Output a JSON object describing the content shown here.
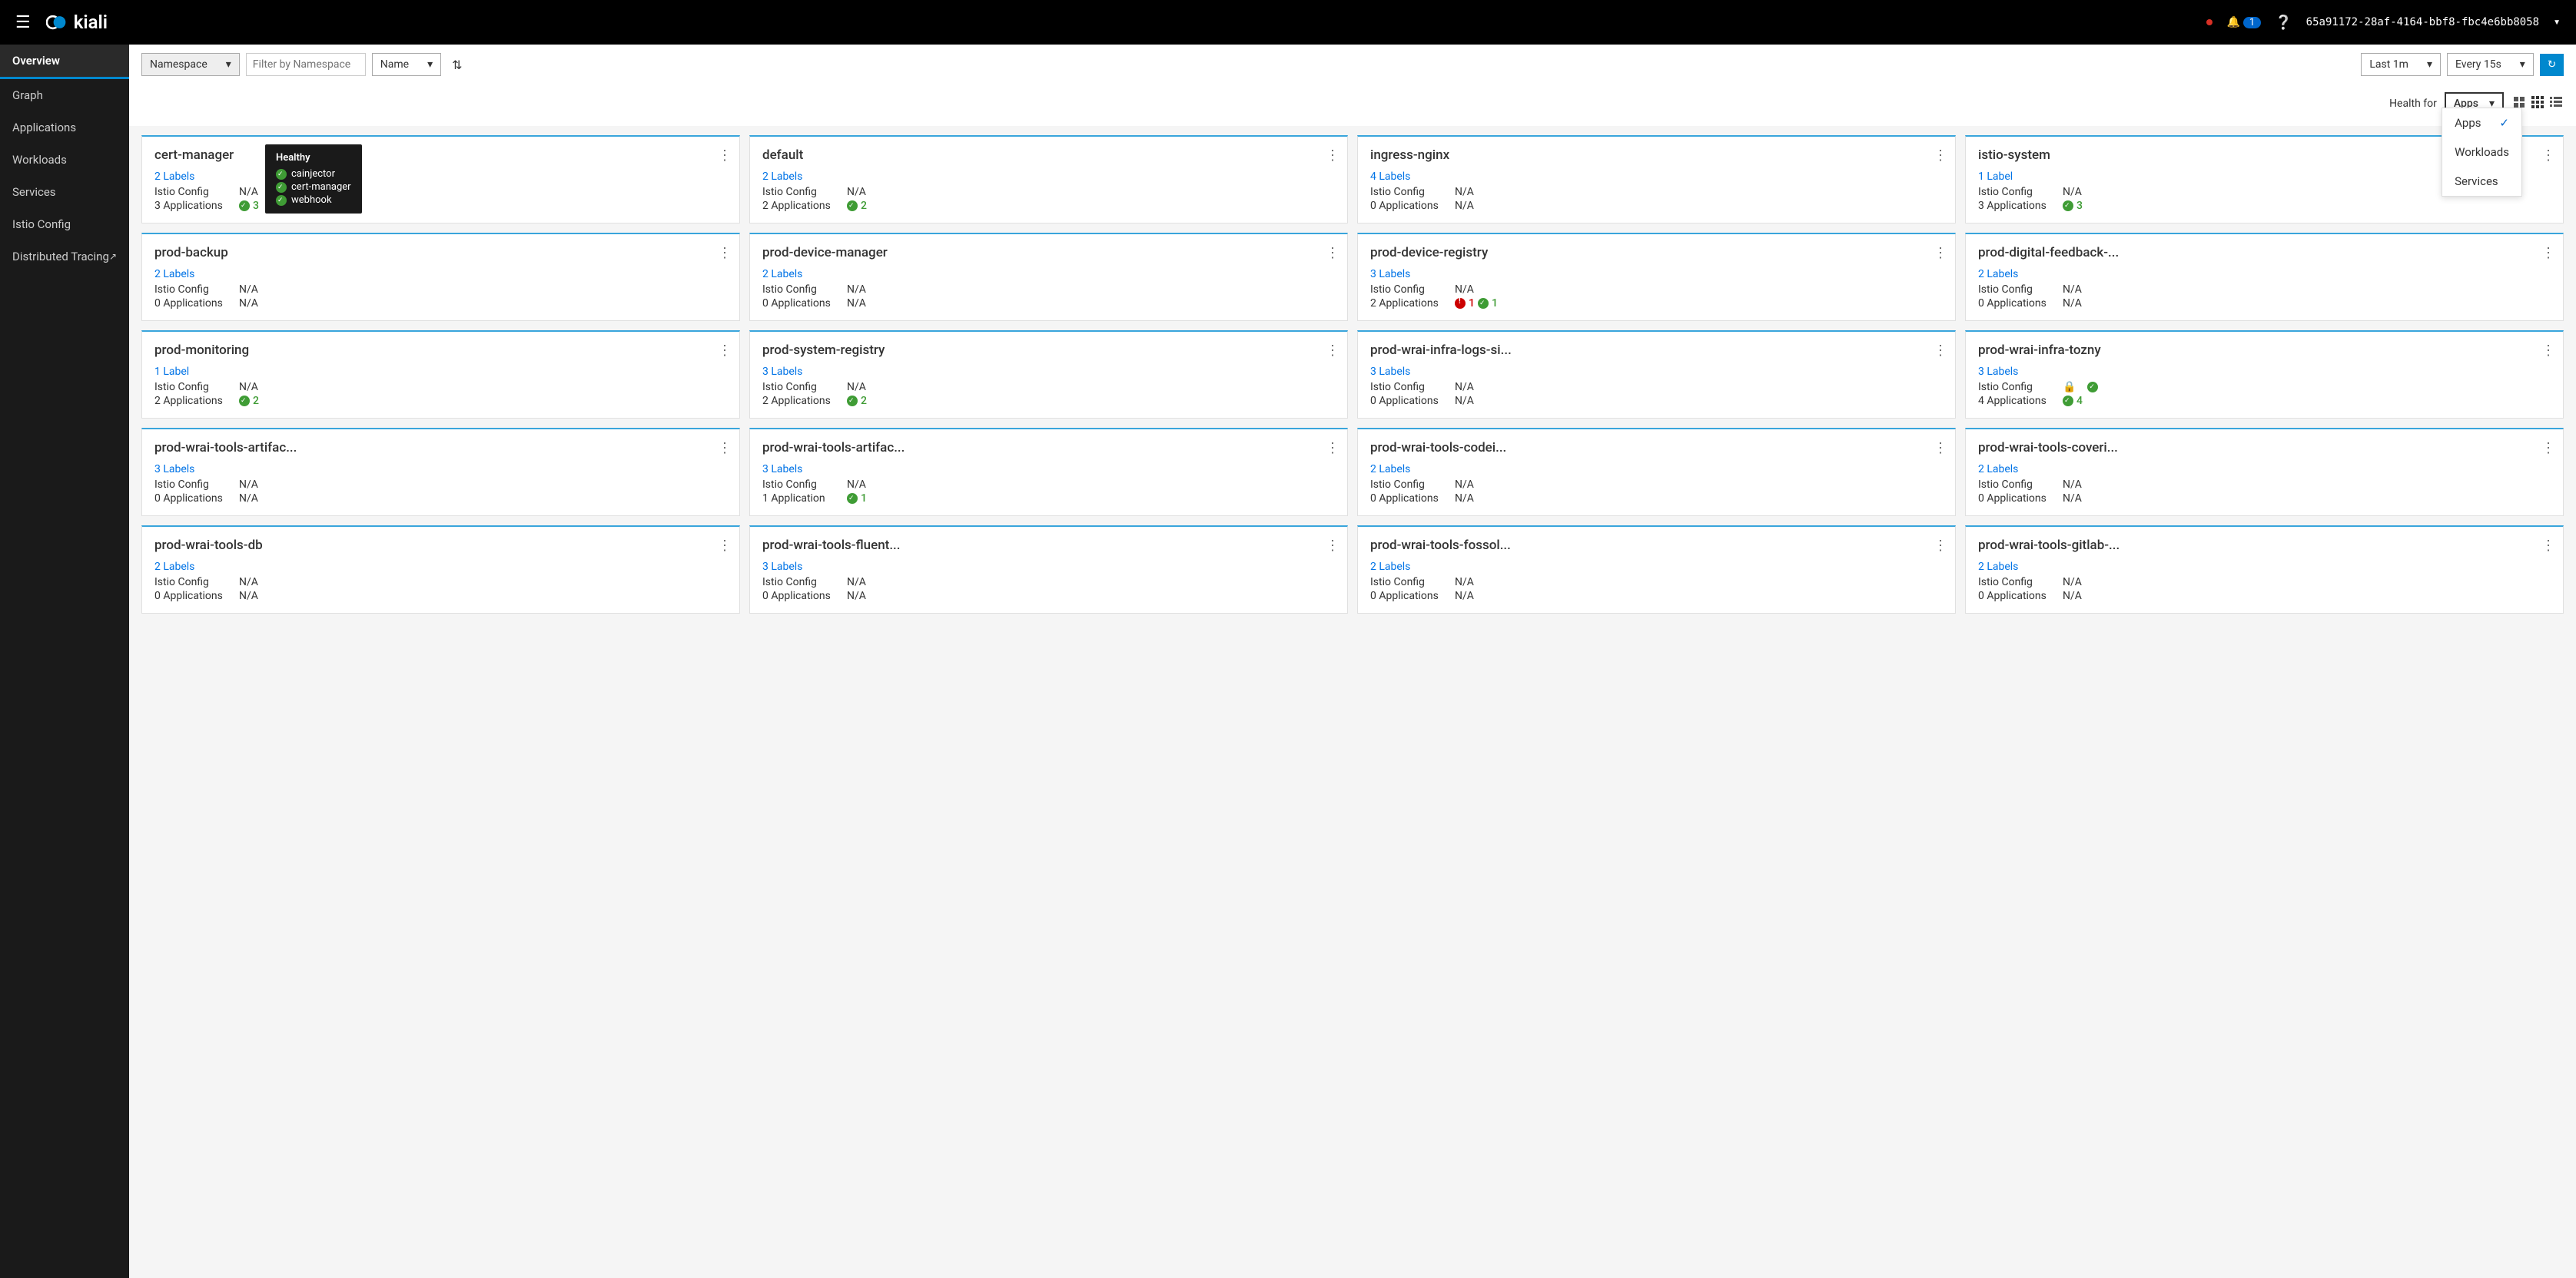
{
  "header": {
    "brand": "kiali",
    "notification_count": "1",
    "user_id": "65a91172-28af-4164-bbf8-fbc4e6bb8058"
  },
  "sidebar": {
    "items": [
      {
        "label": "Overview",
        "active": true
      },
      {
        "label": "Graph"
      },
      {
        "label": "Applications"
      },
      {
        "label": "Workloads"
      },
      {
        "label": "Services"
      },
      {
        "label": "Istio Config"
      },
      {
        "label": "Distributed Tracing",
        "external": true
      }
    ]
  },
  "toolbar": {
    "namespace_label": "Namespace",
    "filter_placeholder": "Filter by Namespace",
    "name_label": "Name",
    "time_range": "Last 1m",
    "refresh_interval": "Every 15s"
  },
  "health": {
    "label": "Health for",
    "selected": "Apps",
    "options": [
      {
        "label": "Apps",
        "selected": true
      },
      {
        "label": "Workloads"
      },
      {
        "label": "Services"
      }
    ]
  },
  "tooltip": {
    "title": "Healthy",
    "items": [
      "cainjector",
      "cert-manager",
      "webhook"
    ]
  },
  "cards": [
    {
      "title": "cert-manager",
      "labels": "2 Labels",
      "istio": "N/A",
      "apps_label": "3 Applications",
      "apps_value": "3",
      "apps_health": "ok",
      "has_tooltip": true
    },
    {
      "title": "default",
      "labels": "2 Labels",
      "istio": "N/A",
      "apps_label": "2 Applications",
      "apps_value": "2",
      "apps_health": "ok"
    },
    {
      "title": "ingress-nginx",
      "labels": "4 Labels",
      "istio": "N/A",
      "apps_label": "0 Applications",
      "apps_value": "N/A"
    },
    {
      "title": "istio-system",
      "labels": "1 Label",
      "istio": "N/A",
      "apps_label": "3 Applications",
      "apps_value": "3",
      "apps_health": "ok"
    },
    {
      "title": "prod-backup",
      "labels": "2 Labels",
      "istio": "N/A",
      "apps_label": "0 Applications",
      "apps_value": "N/A"
    },
    {
      "title": "prod-device-manager",
      "labels": "2 Labels",
      "istio": "N/A",
      "apps_label": "0 Applications",
      "apps_value": "N/A"
    },
    {
      "title": "prod-device-registry",
      "labels": "3 Labels",
      "istio": "N/A",
      "apps_label": "2 Applications",
      "apps_mixed": {
        "err": "1",
        "ok": "1"
      }
    },
    {
      "title": "prod-digital-feedback-...",
      "labels": "2 Labels",
      "istio": "N/A",
      "apps_label": "0 Applications",
      "apps_value": "N/A"
    },
    {
      "title": "prod-monitoring",
      "labels": "1 Label",
      "istio": "N/A",
      "apps_label": "2 Applications",
      "apps_value": "2",
      "apps_health": "ok"
    },
    {
      "title": "prod-system-registry",
      "labels": "3 Labels",
      "istio": "N/A",
      "apps_label": "2 Applications",
      "apps_value": "2",
      "apps_health": "ok"
    },
    {
      "title": "prod-wrai-infra-logs-si...",
      "labels": "3 Labels",
      "istio": "N/A",
      "apps_label": "0 Applications",
      "apps_value": "N/A"
    },
    {
      "title": "prod-wrai-infra-tozny",
      "labels": "3 Labels",
      "istio": "lock-ok",
      "apps_label": "4 Applications",
      "apps_value": "4",
      "apps_health": "ok"
    },
    {
      "title": "prod-wrai-tools-artifac...",
      "labels": "3 Labels",
      "istio": "N/A",
      "apps_label": "0 Applications",
      "apps_value": "N/A"
    },
    {
      "title": "prod-wrai-tools-artifac...",
      "labels": "3 Labels",
      "istio": "N/A",
      "apps_label": "1 Application",
      "apps_value": "1",
      "apps_health": "ok"
    },
    {
      "title": "prod-wrai-tools-codei...",
      "labels": "2 Labels",
      "istio": "N/A",
      "apps_label": "0 Applications",
      "apps_value": "N/A"
    },
    {
      "title": "prod-wrai-tools-coveri...",
      "labels": "2 Labels",
      "istio": "N/A",
      "apps_label": "0 Applications",
      "apps_value": "N/A"
    },
    {
      "title": "prod-wrai-tools-db",
      "labels": "2 Labels",
      "istio": "N/A",
      "apps_label": "0 Applications",
      "apps_value": "N/A"
    },
    {
      "title": "prod-wrai-tools-fluent...",
      "labels": "3 Labels",
      "istio": "N/A",
      "apps_label": "0 Applications",
      "apps_value": "N/A"
    },
    {
      "title": "prod-wrai-tools-fossol...",
      "labels": "2 Labels",
      "istio": "N/A",
      "apps_label": "0 Applications",
      "apps_value": "N/A"
    },
    {
      "title": "prod-wrai-tools-gitlab-...",
      "labels": "2 Labels",
      "istio": "N/A",
      "apps_label": "0 Applications",
      "apps_value": "N/A"
    }
  ],
  "row_labels": {
    "istio": "Istio Config"
  }
}
